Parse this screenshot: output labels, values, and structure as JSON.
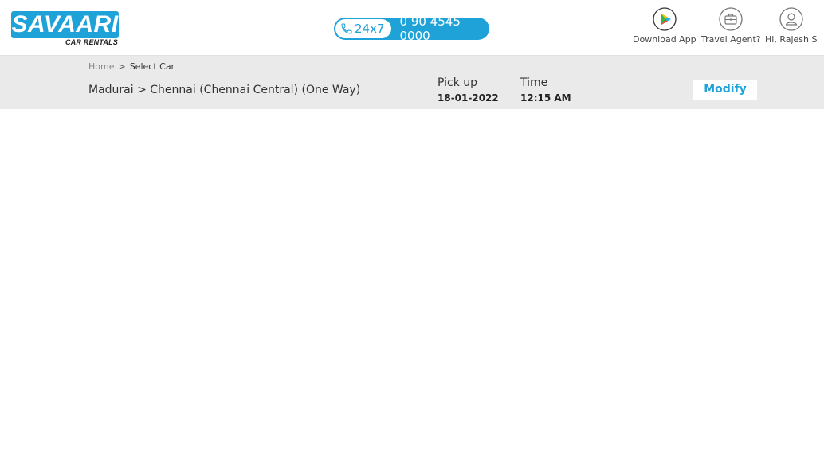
{
  "header": {
    "logo": {
      "name": "SAVAARI",
      "tagline": "CAR RENTALS",
      "brand_color": "#1fa2d8"
    },
    "support": {
      "icon": "phone-icon",
      "availability": "24x7",
      "phone_number": "0 90 4545 0000"
    },
    "actions": [
      {
        "label": "Download App",
        "icon": "play-store-icon"
      },
      {
        "label": "Travel Agent?",
        "icon": "briefcase-icon"
      },
      {
        "label": "Hi, Rajesh S",
        "icon": "user-icon"
      }
    ]
  },
  "breadcrumb": {
    "home": "Home",
    "separator": ">",
    "current": "Select Car"
  },
  "trip": {
    "route": "Madurai > Chennai (Chennai Central) (One Way)",
    "pickup_label": "Pick up",
    "pickup_date": "18-01-2022",
    "time_label": "Time",
    "time_value": "12:15 AM",
    "modify_label": "Modify"
  }
}
